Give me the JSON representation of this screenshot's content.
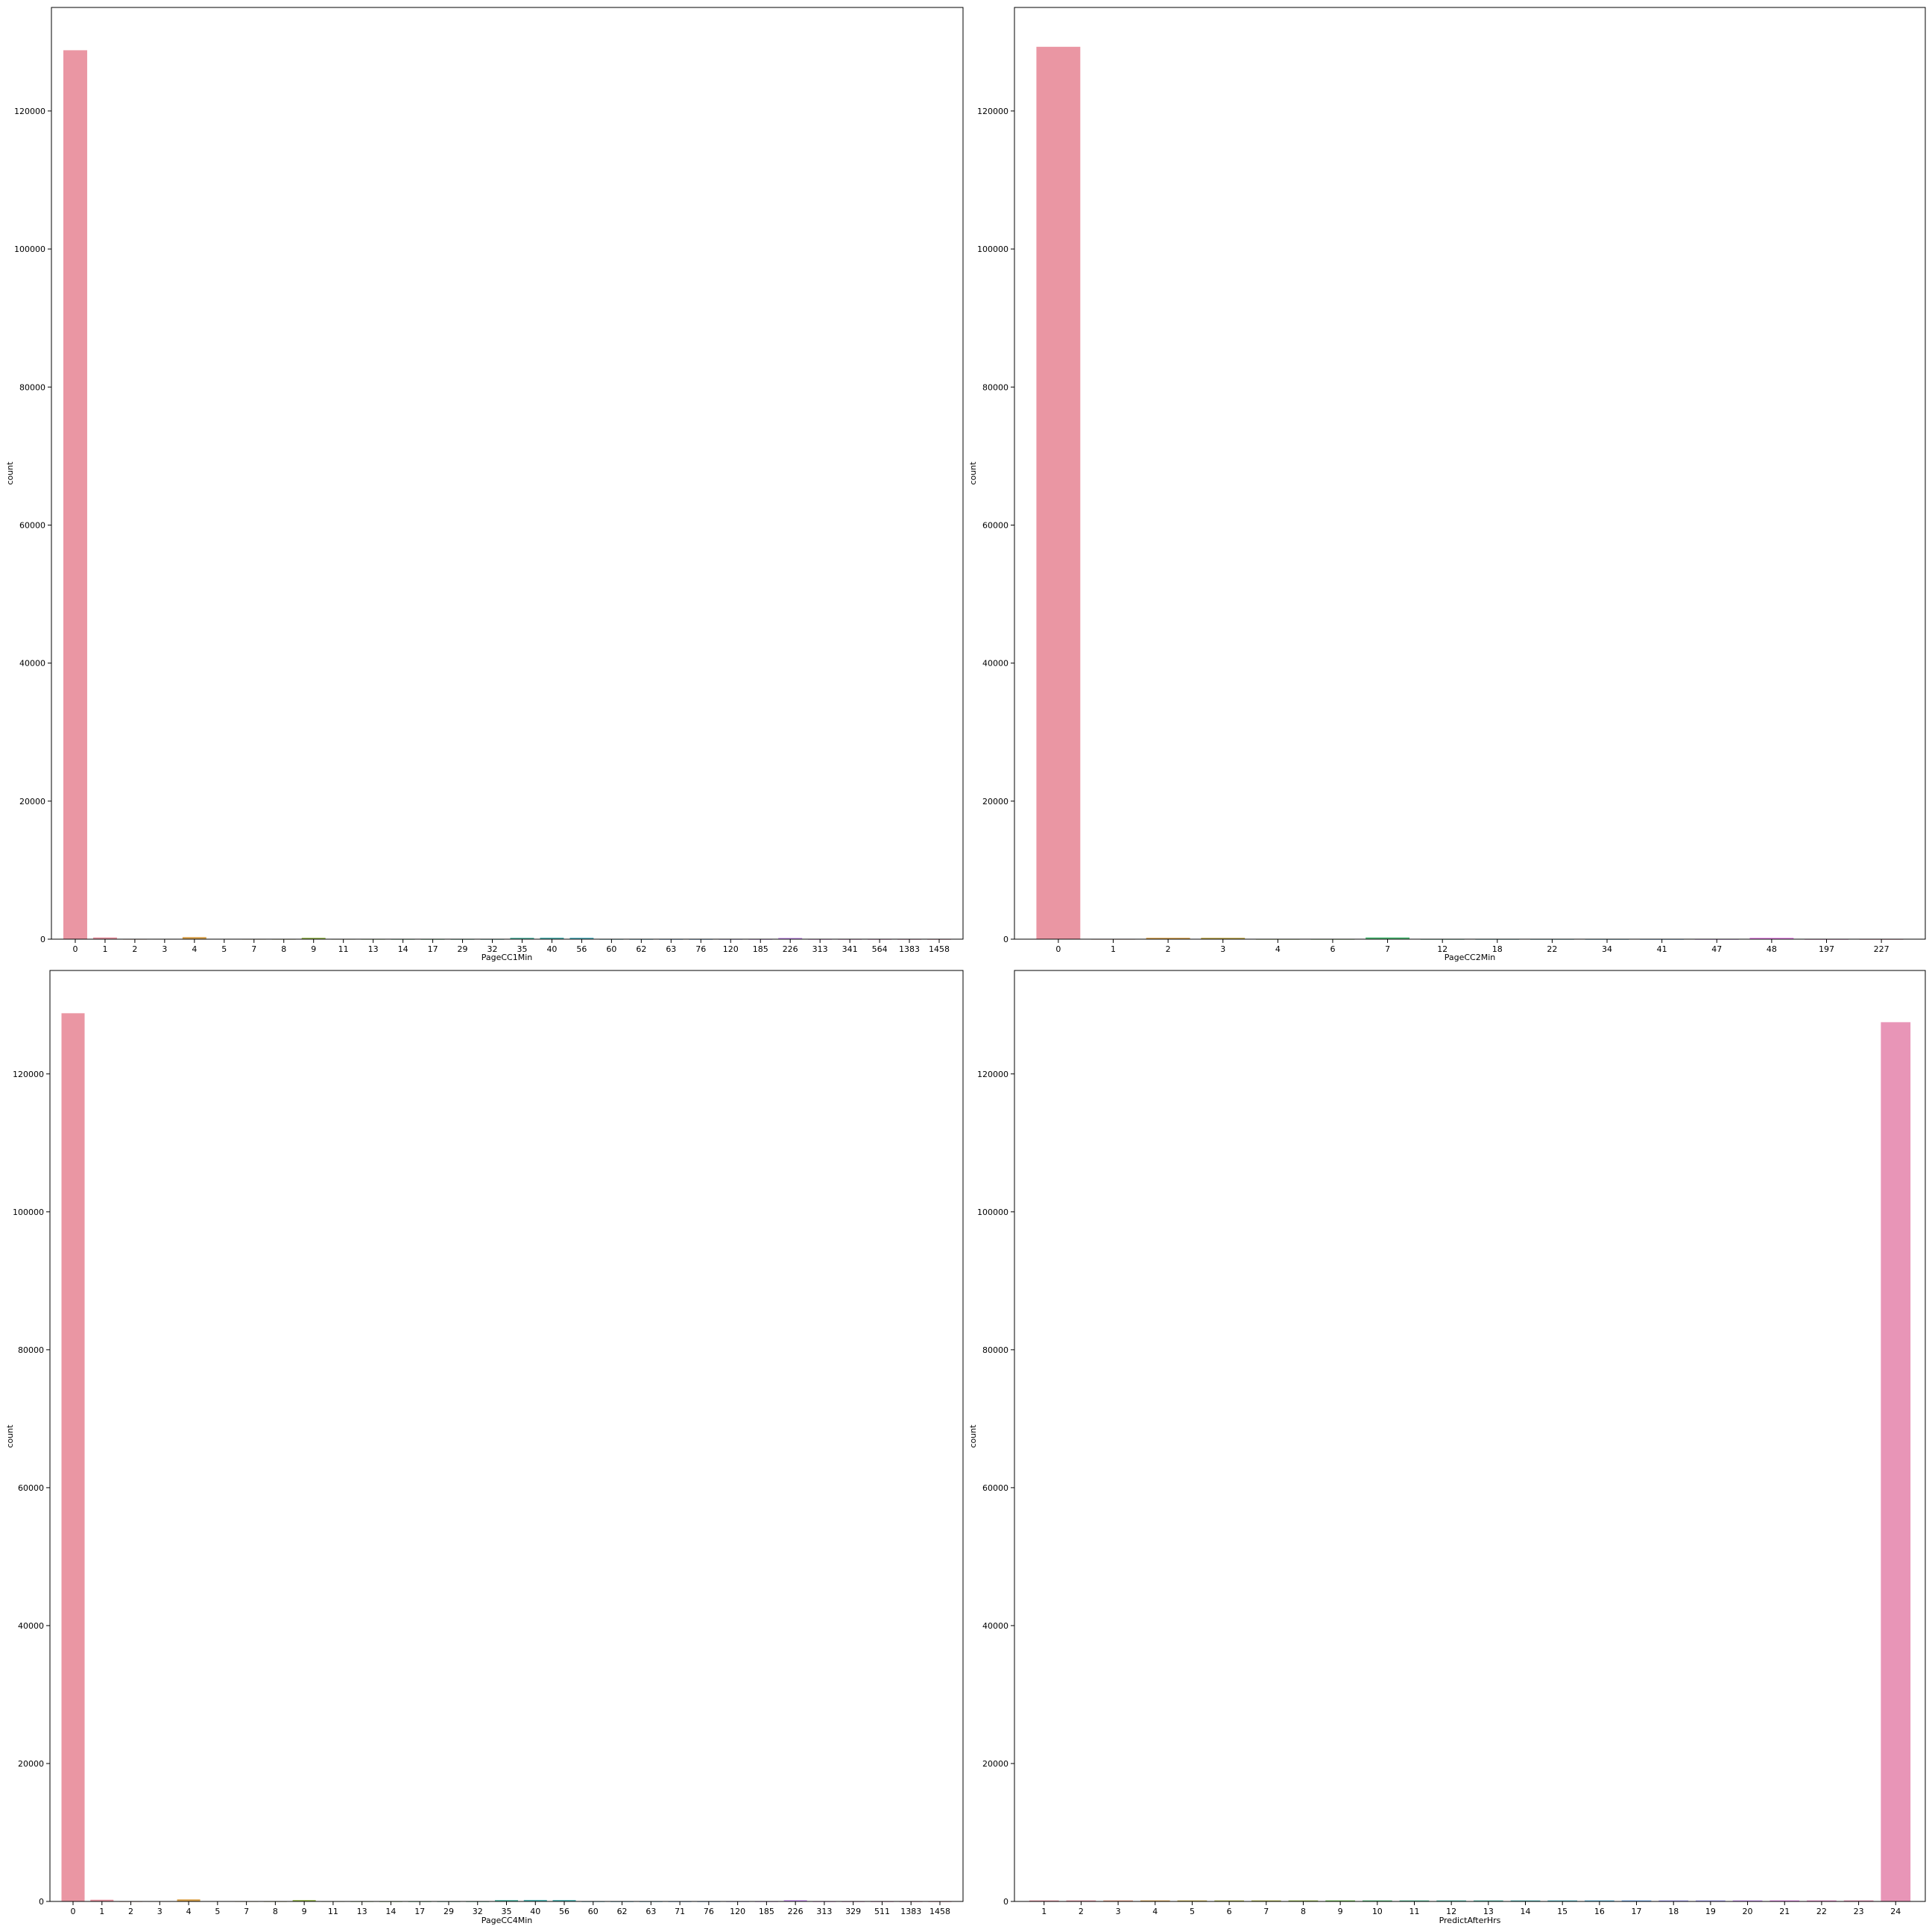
{
  "colors": {
    "background": "#ffffff",
    "axes_frame": "#000000",
    "main_bar_pink": "#ea96a3",
    "main_bar_magenta": "#e895b7",
    "palette": [
      "#ea96a3",
      "#e99c82",
      "#d9a24c",
      "#c2aa4a",
      "#acb049",
      "#93b548",
      "#68bb4a",
      "#4fbc76",
      "#4fb992",
      "#51b7a5",
      "#52b5b3",
      "#54b3c2",
      "#58b0d6",
      "#6ca8ec",
      "#a39cf2",
      "#c88ef2",
      "#e684e7",
      "#e98bcb",
      "#ea90b6",
      "#ea94a8"
    ]
  },
  "charts": [
    {
      "type": "bar",
      "xlabel": "PageCC1Min",
      "ylabel": "count",
      "ylim": [
        0,
        135000
      ],
      "yticks": [
        0,
        20000,
        40000,
        60000,
        80000,
        100000,
        120000
      ],
      "categories": [
        "0",
        "1",
        "2",
        "3",
        "4",
        "5",
        "7",
        "8",
        "9",
        "11",
        "13",
        "14",
        "17",
        "29",
        "32",
        "35",
        "40",
        "56",
        "60",
        "62",
        "63",
        "76",
        "120",
        "185",
        "226",
        "313",
        "341",
        "564",
        "1383",
        "1458"
      ],
      "values": [
        128800,
        250,
        20,
        30,
        300,
        40,
        25,
        20,
        200,
        25,
        20,
        15,
        10,
        10,
        8,
        200,
        220,
        210,
        10,
        8,
        8,
        8,
        12,
        8,
        180,
        8,
        8,
        6,
        6,
        6
      ]
    },
    {
      "type": "bar",
      "xlabel": "PageCC2Min",
      "ylabel": "count",
      "ylim": [
        0,
        135000
      ],
      "yticks": [
        0,
        20000,
        40000,
        60000,
        80000,
        100000,
        120000
      ],
      "categories": [
        "0",
        "1",
        "2",
        "3",
        "4",
        "6",
        "7",
        "12",
        "18",
        "22",
        "34",
        "41",
        "47",
        "48",
        "197",
        "227"
      ],
      "values": [
        129300,
        20,
        200,
        200,
        15,
        15,
        250,
        10,
        10,
        10,
        8,
        8,
        8,
        200,
        6,
        6
      ]
    },
    {
      "type": "bar",
      "xlabel": "PageCC4Min",
      "ylabel": "count",
      "ylim": [
        0,
        135000
      ],
      "yticks": [
        0,
        20000,
        40000,
        60000,
        80000,
        100000,
        120000
      ],
      "categories": [
        "0",
        "1",
        "2",
        "3",
        "4",
        "5",
        "7",
        "8",
        "9",
        "11",
        "13",
        "14",
        "17",
        "29",
        "32",
        "35",
        "40",
        "56",
        "60",
        "62",
        "63",
        "71",
        "76",
        "120",
        "185",
        "226",
        "313",
        "329",
        "511",
        "1383",
        "1458"
      ],
      "values": [
        128800,
        250,
        20,
        30,
        300,
        40,
        25,
        20,
        200,
        25,
        20,
        15,
        10,
        10,
        8,
        200,
        220,
        210,
        10,
        8,
        8,
        8,
        8,
        12,
        8,
        180,
        8,
        8,
        6,
        6,
        6
      ]
    },
    {
      "type": "bar",
      "xlabel": "PredictAfterHrs",
      "ylabel": "count",
      "ylim": [
        0,
        135000
      ],
      "yticks": [
        0,
        20000,
        40000,
        60000,
        80000,
        100000,
        120000
      ],
      "categories": [
        "1",
        "2",
        "3",
        "4",
        "5",
        "6",
        "7",
        "8",
        "9",
        "10",
        "11",
        "12",
        "13",
        "14",
        "15",
        "16",
        "17",
        "18",
        "19",
        "20",
        "21",
        "22",
        "23",
        "24"
      ],
      "values": [
        150,
        150,
        150,
        150,
        150,
        150,
        150,
        150,
        150,
        150,
        150,
        150,
        150,
        150,
        150,
        150,
        150,
        150,
        150,
        150,
        150,
        150,
        150,
        127500
      ]
    }
  ]
}
